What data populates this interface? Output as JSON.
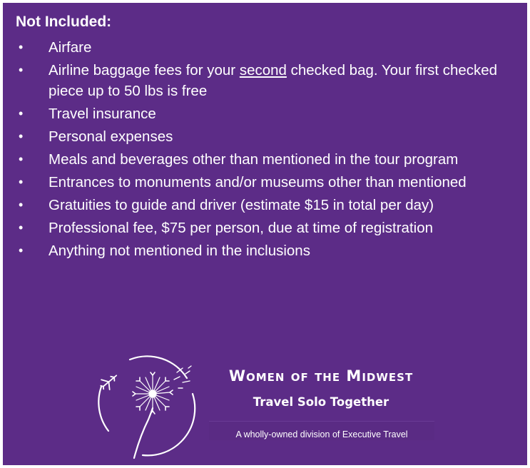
{
  "heading": "Not Included:",
  "bullet_char": "•",
  "items": [
    {
      "text": "Airfare"
    },
    {
      "before": "Airline baggage fees for your ",
      "underlined": "second",
      "after": " checked bag. Your first checked piece up to 50 lbs is free"
    },
    {
      "text": "Travel insurance"
    },
    {
      "text": "Personal expenses"
    },
    {
      "text": "Meals and beverages other than mentioned in the tour program"
    },
    {
      "text": "Entrances to monuments and/or museums other than mentioned"
    },
    {
      "text": "Gratuities to guide and driver (estimate $15 in total per day)"
    },
    {
      "text": "Professional fee, $75 per person, due at time of registration"
    },
    {
      "text": "Anything not mentioned in the inclusions"
    }
  ],
  "brand": {
    "name": "Women of the Midwest",
    "tagline": "Travel Solo Together",
    "division": "A wholly-owned division of Executive Travel",
    "logo_icon": "dandelion-airplane-logo"
  },
  "colors": {
    "background": "#5c2c87",
    "text": "#ffffff"
  }
}
